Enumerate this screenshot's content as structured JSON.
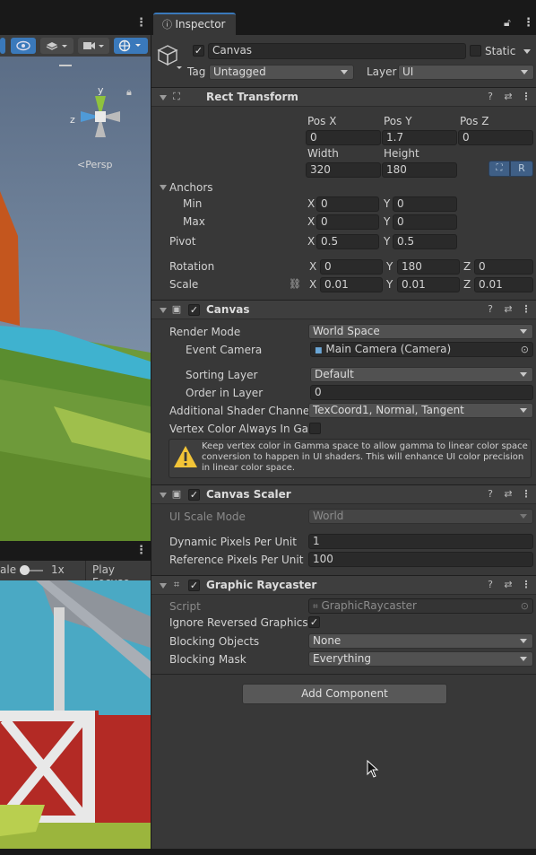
{
  "inspector": {
    "tab_label": "Inspector",
    "object": {
      "name": "Canvas",
      "static_label": "Static",
      "tag_label": "Tag",
      "tag_value": "Untagged",
      "layer_label": "Layer",
      "layer_value": "UI"
    },
    "rect_transform": {
      "title": "Rect Transform",
      "pos_x_label": "Pos X",
      "pos_y_label": "Pos Y",
      "pos_z_label": "Pos Z",
      "pos_x": "0",
      "pos_y": "1.7",
      "pos_z": "0",
      "width_label": "Width",
      "height_label": "Height",
      "width": "320",
      "height": "180",
      "r_button": "R",
      "anchors_label": "Anchors",
      "min_label": "Min",
      "max_label": "Max",
      "min_x": "0",
      "min_y": "0",
      "max_x": "0",
      "max_y": "0",
      "pivot_label": "Pivot",
      "pivot_x": "0.5",
      "pivot_y": "0.5",
      "rotation_label": "Rotation",
      "rot_x": "0",
      "rot_y": "180",
      "rot_z": "0",
      "scale_label": "Scale",
      "scale_x": "0.01",
      "scale_y": "0.01",
      "scale_z": "0.01",
      "x": "X",
      "y": "Y",
      "z": "Z"
    },
    "canvas": {
      "title": "Canvas",
      "render_mode_label": "Render Mode",
      "render_mode": "World Space",
      "event_camera_label": "Event Camera",
      "event_camera": "Main Camera (Camera)",
      "sorting_layer_label": "Sorting Layer",
      "sorting_layer": "Default",
      "order_label": "Order in Layer",
      "order": "0",
      "shader_channels_label": "Additional Shader Channels",
      "shader_channels": "TexCoord1, Normal, Tangent",
      "vertex_color_label": "Vertex Color Always In Gam",
      "warning": "Keep vertex color in Gamma space to allow gamma to linear color space conversion to happen in UI shaders. This will enhance UI color precision in linear color space."
    },
    "canvas_scaler": {
      "title": "Canvas Scaler",
      "ui_scale_mode_label": "UI Scale Mode",
      "ui_scale_mode": "World",
      "dynamic_label": "Dynamic Pixels Per Unit",
      "dynamic": "1",
      "reference_label": "Reference Pixels Per Unit",
      "reference": "100"
    },
    "graphic_raycaster": {
      "title": "Graphic Raycaster",
      "script_label": "Script",
      "script": "GraphicRaycaster",
      "ignore_reversed_label": "Ignore Reversed Graphics",
      "blocking_objects_label": "Blocking Objects",
      "blocking_objects": "None",
      "blocking_mask_label": "Blocking Mask",
      "blocking_mask": "Everything"
    },
    "add_component": "Add Component"
  },
  "scene": {
    "gizmo_y": "y",
    "gizmo_z": "z",
    "persp_label": "<Persp"
  },
  "game": {
    "scale_label": "ale",
    "scale_value": "1x",
    "play_focused": "Play Focuse"
  },
  "colors": {
    "accent": "#3a79bb",
    "sky": "#4aa9c4",
    "grass": "#76a043",
    "barn_red": "#b32a25"
  }
}
